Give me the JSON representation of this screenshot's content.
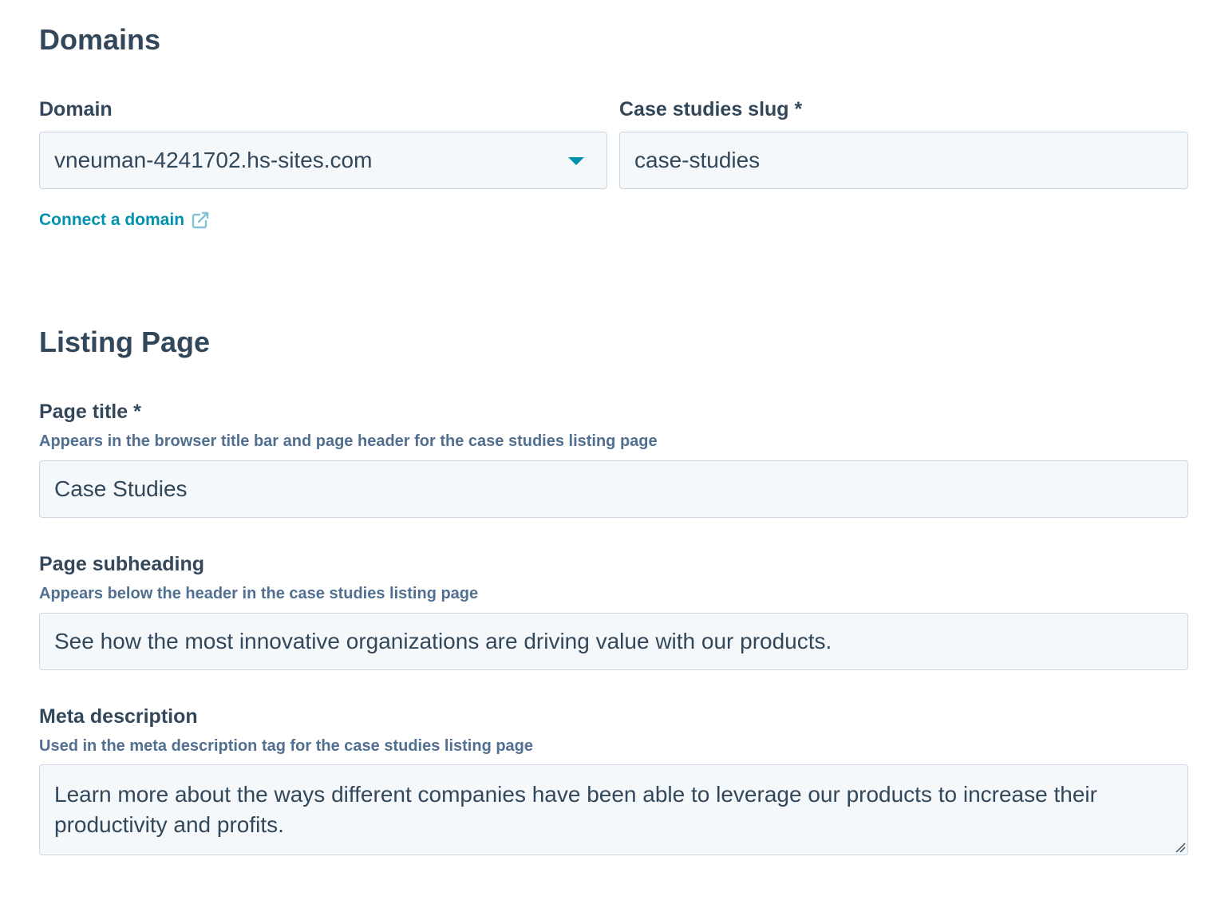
{
  "domains": {
    "title": "Domains",
    "domain_label": "Domain",
    "domain_value": "vneuman-4241702.hs-sites.com",
    "slug_label": "Case studies slug *",
    "slug_value": "case-studies",
    "connect_link": "Connect a domain"
  },
  "listing": {
    "title": "Listing Page",
    "page_title_label": "Page title *",
    "page_title_help": "Appears in the browser title bar and page header for the case studies listing page",
    "page_title_value": "Case Studies",
    "subheading_label": "Page subheading",
    "subheading_help": "Appears below the header in the case studies listing page",
    "subheading_value": "See how the most innovative organizations are driving value with our products.",
    "meta_label": "Meta description",
    "meta_help": "Used in the meta description tag for the case studies listing page",
    "meta_value": "Learn more about the ways different companies have been able to leverage our products to increase their productivity and profits."
  },
  "icons": {
    "caret": "chevron-down-icon",
    "external": "external-link-icon",
    "grip": "resize-grip-icon"
  },
  "colors": {
    "text": "#33475b",
    "help": "#516f90",
    "accent": "#0091ae",
    "field_bg": "#f5f8fa",
    "field_border": "#cbd6e2"
  }
}
